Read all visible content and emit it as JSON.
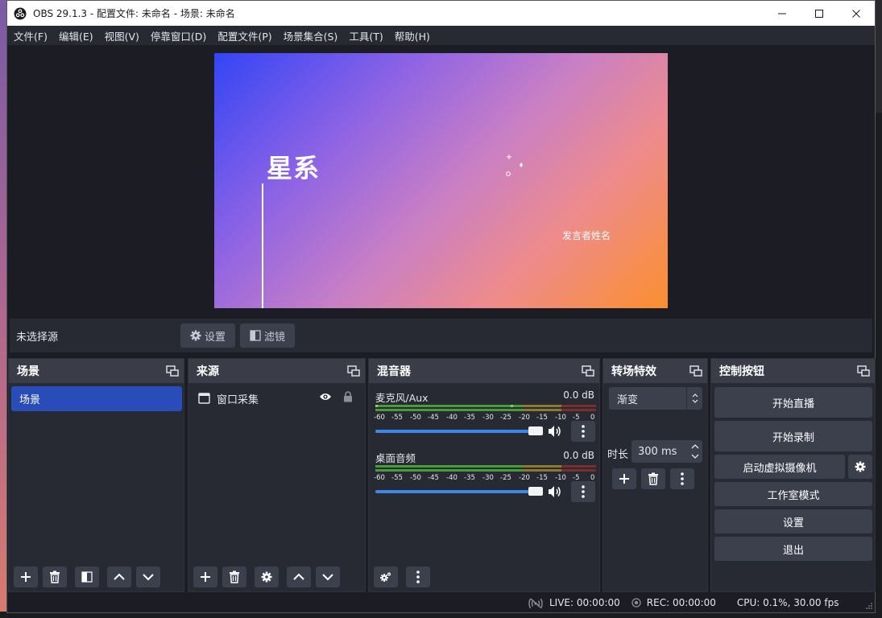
{
  "window": {
    "title": "OBS 29.1.3 - 配置文件: 未命名 - 场景: 未命名",
    "app_icon": "obs-logo-icon",
    "controls": [
      "minimize-icon",
      "maximize-icon",
      "close-icon"
    ]
  },
  "menu": [
    "文件(F)",
    "编辑(E)",
    "视图(V)",
    "停靠窗口(D)",
    "配置文件(P)",
    "场景集合(S)",
    "工具(T)",
    "帮助(H)"
  ],
  "preview": {
    "headline": "星系",
    "speaker": "发言者姓名",
    "gradient_colors": [
      "#3345f5",
      "#8b62e6",
      "#c77fc6",
      "#ee8b8c",
      "#fb8f2e"
    ]
  },
  "source_toolbar": {
    "no_source": "未选择源",
    "settings_label": "设置",
    "filters_label": "滤镜"
  },
  "scenes": {
    "title": "场景",
    "items": [
      {
        "label": "场景",
        "selected": true
      }
    ]
  },
  "sources": {
    "title": "来源",
    "items": [
      {
        "label": "窗口采集",
        "visible": true,
        "locked": false
      }
    ]
  },
  "mixer": {
    "title": "混音器",
    "tick_labels": [
      "-60",
      "-55",
      "-50",
      "-45",
      "-40",
      "-35",
      "-30",
      "-25",
      "-20",
      "-15",
      "-10",
      "-5",
      "0"
    ],
    "channels": [
      {
        "name": "麦克风/Aux",
        "db": "0.0 dB",
        "volume_percent": 100
      },
      {
        "name": "桌面音频",
        "db": "0.0 dB",
        "volume_percent": 100
      }
    ]
  },
  "transitions": {
    "title": "转场特效",
    "selected": "渐变",
    "duration_label": "时长",
    "duration_value": "300 ms"
  },
  "controls": {
    "title": "控制按钮",
    "start_stream": "开始直播",
    "start_record": "开始录制",
    "start_virtual_cam": "启动虚拟摄像机",
    "studio_mode": "工作室模式",
    "settings": "设置",
    "exit": "退出"
  },
  "status": {
    "live": "LIVE: 00:00:00",
    "rec": "REC: 00:00:00",
    "cpu": "CPU: 0.1%, 30.00 fps"
  },
  "colors": {
    "accent": "#284cb8",
    "panel": "#272a33",
    "panel_header": "#3a3d48",
    "button": "#3c404d",
    "volume": "#3d87e6"
  }
}
